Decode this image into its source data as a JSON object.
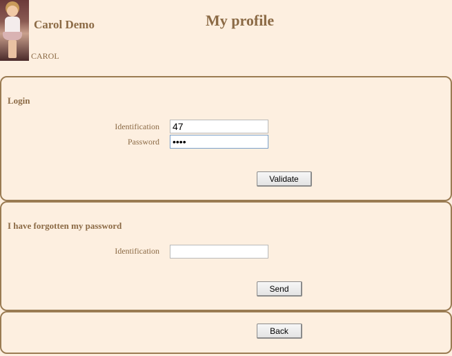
{
  "header": {
    "user_name": "Carol Demo",
    "user_login": "CAROL",
    "page_title": "My profile"
  },
  "login": {
    "title": "Login",
    "identification_label": "Identification",
    "identification_value": "47",
    "password_label": "Password",
    "password_value": "1234",
    "validate_label": "Validate"
  },
  "forgot": {
    "title": "I have forgotten my password",
    "identification_label": "Identification",
    "identification_value": "",
    "send_label": "Send"
  },
  "footer": {
    "back_label": "Back"
  },
  "colors": {
    "background": "#fdefe0",
    "text": "#8b6a45",
    "panel_border": "#9a7b52"
  }
}
